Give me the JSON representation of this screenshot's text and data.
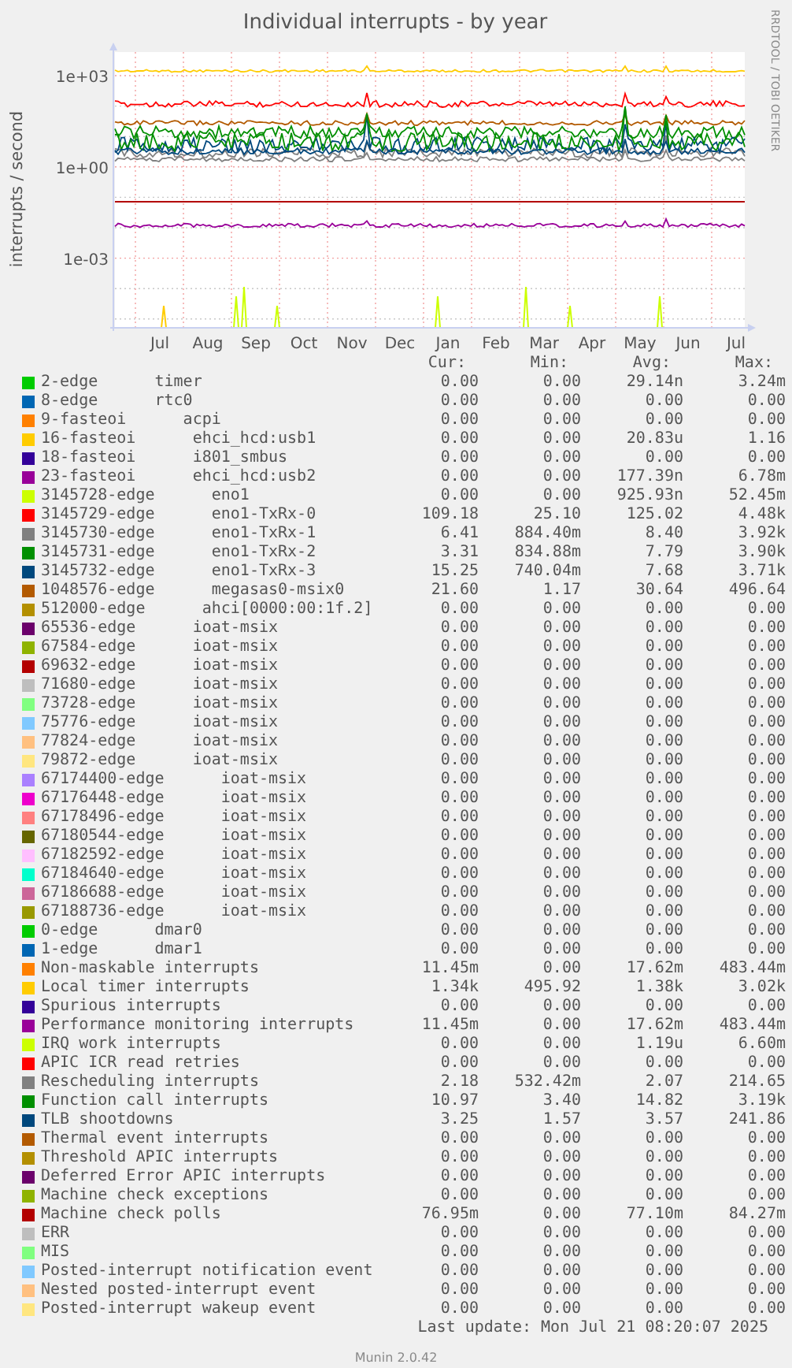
{
  "chart": {
    "title": "Individual interrupts - by year",
    "ylabel": "interrupts / second",
    "yticks": [
      "1e+03",
      "1e+00",
      "1e-03"
    ],
    "months": [
      "Jul",
      "Aug",
      "Sep",
      "Oct",
      "Nov",
      "Dec",
      "Jan",
      "Feb",
      "Mar",
      "Apr",
      "May",
      "Jun",
      "Jul"
    ],
    "credit": "RRDTOOL / TOBI OETIKER"
  },
  "legend": {
    "columns": [
      "Cur:",
      "Min:",
      "Avg:",
      "Max:"
    ],
    "rows": [
      {
        "name": "2-edge",
        "device": "timer",
        "color": "#00cc00",
        "cur": "0.00",
        "min": "0.00",
        "avg": "29.14n",
        "max": "3.24m"
      },
      {
        "name": "8-edge",
        "device": "rtc0",
        "color": "#0066b3",
        "cur": "0.00",
        "min": "0.00",
        "avg": "0.00",
        "max": "0.00"
      },
      {
        "name": "9-fasteoi",
        "device": "acpi",
        "color": "#ff8000",
        "cur": "0.00",
        "min": "0.00",
        "avg": "0.00",
        "max": "0.00"
      },
      {
        "name": "16-fasteoi",
        "device": "ehci_hcd:usb1",
        "color": "#ffcc00",
        "cur": "0.00",
        "min": "0.00",
        "avg": "20.83u",
        "max": "1.16"
      },
      {
        "name": "18-fasteoi",
        "device": "i801_smbus",
        "color": "#330099",
        "cur": "0.00",
        "min": "0.00",
        "avg": "0.00",
        "max": "0.00"
      },
      {
        "name": "23-fasteoi",
        "device": "ehci_hcd:usb2",
        "color": "#990099",
        "cur": "0.00",
        "min": "0.00",
        "avg": "177.39n",
        "max": "6.78m"
      },
      {
        "name": "3145728-edge",
        "device": "eno1",
        "color": "#ccff00",
        "cur": "0.00",
        "min": "0.00",
        "avg": "925.93n",
        "max": "52.45m"
      },
      {
        "name": "3145729-edge",
        "device": "eno1-TxRx-0",
        "color": "#ff0000",
        "cur": "109.18",
        "min": "25.10",
        "avg": "125.02",
        "max": "4.48k"
      },
      {
        "name": "3145730-edge",
        "device": "eno1-TxRx-1",
        "color": "#808080",
        "cur": "6.41",
        "min": "884.40m",
        "avg": "8.40",
        "max": "3.92k"
      },
      {
        "name": "3145731-edge",
        "device": "eno1-TxRx-2",
        "color": "#008f00",
        "cur": "3.31",
        "min": "834.88m",
        "avg": "7.79",
        "max": "3.90k"
      },
      {
        "name": "3145732-edge",
        "device": "eno1-TxRx-3",
        "color": "#00487d",
        "cur": "15.25",
        "min": "740.04m",
        "avg": "7.68",
        "max": "3.71k"
      },
      {
        "name": "1048576-edge",
        "device": "megasas0-msix0",
        "color": "#b35a00",
        "cur": "21.60",
        "min": "1.17",
        "avg": "30.64",
        "max": "496.64"
      },
      {
        "name": "512000-edge",
        "device": "ahci[0000:00:1f.2]",
        "color": "#b38f00",
        "cur": "0.00",
        "min": "0.00",
        "avg": "0.00",
        "max": "0.00"
      },
      {
        "name": "65536-edge",
        "device": "ioat-msix",
        "color": "#6b006b",
        "cur": "0.00",
        "min": "0.00",
        "avg": "0.00",
        "max": "0.00"
      },
      {
        "name": "67584-edge",
        "device": "ioat-msix",
        "color": "#8fb300",
        "cur": "0.00",
        "min": "0.00",
        "avg": "0.00",
        "max": "0.00"
      },
      {
        "name": "69632-edge",
        "device": "ioat-msix",
        "color": "#b30000",
        "cur": "0.00",
        "min": "0.00",
        "avg": "0.00",
        "max": "0.00"
      },
      {
        "name": "71680-edge",
        "device": "ioat-msix",
        "color": "#bebebe",
        "cur": "0.00",
        "min": "0.00",
        "avg": "0.00",
        "max": "0.00"
      },
      {
        "name": "73728-edge",
        "device": "ioat-msix",
        "color": "#80ff80",
        "cur": "0.00",
        "min": "0.00",
        "avg": "0.00",
        "max": "0.00"
      },
      {
        "name": "75776-edge",
        "device": "ioat-msix",
        "color": "#80c9ff",
        "cur": "0.00",
        "min": "0.00",
        "avg": "0.00",
        "max": "0.00"
      },
      {
        "name": "77824-edge",
        "device": "ioat-msix",
        "color": "#ffc080",
        "cur": "0.00",
        "min": "0.00",
        "avg": "0.00",
        "max": "0.00"
      },
      {
        "name": "79872-edge",
        "device": "ioat-msix",
        "color": "#ffe680",
        "cur": "0.00",
        "min": "0.00",
        "avg": "0.00",
        "max": "0.00"
      },
      {
        "name": "67174400-edge",
        "device": "ioat-msix",
        "color": "#aa80ff",
        "cur": "0.00",
        "min": "0.00",
        "avg": "0.00",
        "max": "0.00"
      },
      {
        "name": "67176448-edge",
        "device": "ioat-msix",
        "color": "#ee00cc",
        "cur": "0.00",
        "min": "0.00",
        "avg": "0.00",
        "max": "0.00"
      },
      {
        "name": "67178496-edge",
        "device": "ioat-msix",
        "color": "#ff8080",
        "cur": "0.00",
        "min": "0.00",
        "avg": "0.00",
        "max": "0.00"
      },
      {
        "name": "67180544-edge",
        "device": "ioat-msix",
        "color": "#666600",
        "cur": "0.00",
        "min": "0.00",
        "avg": "0.00",
        "max": "0.00"
      },
      {
        "name": "67182592-edge",
        "device": "ioat-msix",
        "color": "#ffbfff",
        "cur": "0.00",
        "min": "0.00",
        "avg": "0.00",
        "max": "0.00"
      },
      {
        "name": "67184640-edge",
        "device": "ioat-msix",
        "color": "#00ffcc",
        "cur": "0.00",
        "min": "0.00",
        "avg": "0.00",
        "max": "0.00"
      },
      {
        "name": "67186688-edge",
        "device": "ioat-msix",
        "color": "#cc6699",
        "cur": "0.00",
        "min": "0.00",
        "avg": "0.00",
        "max": "0.00"
      },
      {
        "name": "67188736-edge",
        "device": "ioat-msix",
        "color": "#999900",
        "cur": "0.00",
        "min": "0.00",
        "avg": "0.00",
        "max": "0.00"
      },
      {
        "name": "0-edge",
        "device": "dmar0",
        "color": "#00cc00",
        "cur": "0.00",
        "min": "0.00",
        "avg": "0.00",
        "max": "0.00"
      },
      {
        "name": "1-edge",
        "device": "dmar1",
        "color": "#0066b3",
        "cur": "0.00",
        "min": "0.00",
        "avg": "0.00",
        "max": "0.00"
      },
      {
        "name": "Non-maskable interrupts",
        "color": "#ff8000",
        "cur": "11.45m",
        "min": "0.00",
        "avg": "17.62m",
        "max": "483.44m"
      },
      {
        "name": "Local timer interrupts",
        "color": "#ffcc00",
        "cur": "1.34k",
        "min": "495.92",
        "avg": "1.38k",
        "max": "3.02k"
      },
      {
        "name": "Spurious interrupts",
        "color": "#330099",
        "cur": "0.00",
        "min": "0.00",
        "avg": "0.00",
        "max": "0.00"
      },
      {
        "name": "Performance monitoring interrupts",
        "color": "#990099",
        "cur": "11.45m",
        "min": "0.00",
        "avg": "17.62m",
        "max": "483.44m"
      },
      {
        "name": "IRQ work interrupts",
        "color": "#ccff00",
        "cur": "0.00",
        "min": "0.00",
        "avg": "1.19u",
        "max": "6.60m"
      },
      {
        "name": "APIC ICR read retries",
        "color": "#ff0000",
        "cur": "0.00",
        "min": "0.00",
        "avg": "0.00",
        "max": "0.00"
      },
      {
        "name": "Rescheduling interrupts",
        "color": "#808080",
        "cur": "2.18",
        "min": "532.42m",
        "avg": "2.07",
        "max": "214.65"
      },
      {
        "name": "Function call interrupts",
        "color": "#008f00",
        "cur": "10.97",
        "min": "3.40",
        "avg": "14.82",
        "max": "3.19k"
      },
      {
        "name": "TLB shootdowns",
        "color": "#00487d",
        "cur": "3.25",
        "min": "1.57",
        "avg": "3.57",
        "max": "241.86"
      },
      {
        "name": "Thermal event interrupts",
        "color": "#b35a00",
        "cur": "0.00",
        "min": "0.00",
        "avg": "0.00",
        "max": "0.00"
      },
      {
        "name": "Threshold APIC interrupts",
        "color": "#b38f00",
        "cur": "0.00",
        "min": "0.00",
        "avg": "0.00",
        "max": "0.00"
      },
      {
        "name": "Deferred Error APIC interrupts",
        "color": "#6b006b",
        "cur": "0.00",
        "min": "0.00",
        "avg": "0.00",
        "max": "0.00"
      },
      {
        "name": "Machine check exceptions",
        "color": "#8fb300",
        "cur": "0.00",
        "min": "0.00",
        "avg": "0.00",
        "max": "0.00"
      },
      {
        "name": "Machine check polls",
        "color": "#b30000",
        "cur": "76.95m",
        "min": "0.00",
        "avg": "77.10m",
        "max": "84.27m"
      },
      {
        "name": "ERR",
        "color": "#bebebe",
        "cur": "0.00",
        "min": "0.00",
        "avg": "0.00",
        "max": "0.00"
      },
      {
        "name": "MIS",
        "color": "#80ff80",
        "cur": "0.00",
        "min": "0.00",
        "avg": "0.00",
        "max": "0.00"
      },
      {
        "name": "Posted-interrupt notification event",
        "color": "#80c9ff",
        "cur": "0.00",
        "min": "0.00",
        "avg": "0.00",
        "max": "0.00"
      },
      {
        "name": "Nested posted-interrupt event",
        "color": "#ffc080",
        "cur": "0.00",
        "min": "0.00",
        "avg": "0.00",
        "max": "0.00"
      },
      {
        "name": "Posted-interrupt wakeup event",
        "color": "#ffe680",
        "cur": "0.00",
        "min": "0.00",
        "avg": "0.00",
        "max": "0.00"
      }
    ]
  },
  "last_update": "Last update: Mon Jul 21 08:20:07 2025",
  "footer": "Munin 2.0.42"
}
